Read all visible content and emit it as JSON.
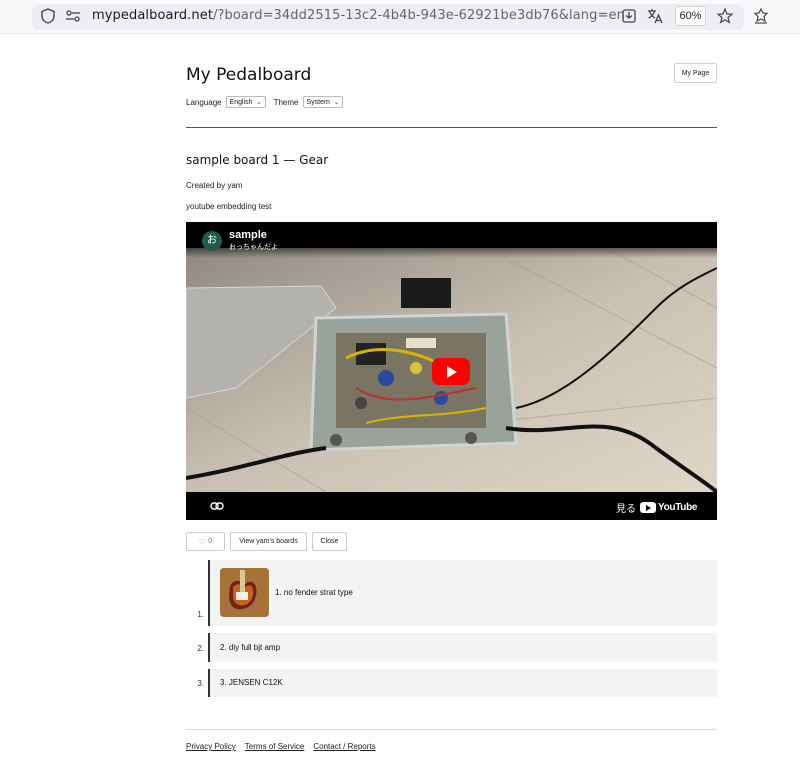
{
  "browser": {
    "url_host": "mypedalboard.net",
    "url_rest": "/?board=34dd2515-13c2-4b4b-943e-62921be3db76&lang=en",
    "zoom": "60%"
  },
  "header": {
    "site_title": "My Pedalboard",
    "my_page_label": "My Page",
    "language_label": "Language",
    "language_value": "English",
    "theme_label": "Theme",
    "theme_value": "System"
  },
  "board": {
    "title": "sample board 1 — Gear",
    "created_by": "Created by yam",
    "description": "youtube embedding test"
  },
  "video": {
    "channel_initial": "お",
    "title": "sample",
    "channel_name": "おっちゃんだよ",
    "watch_on": "見る",
    "youtube_word": "YouTube"
  },
  "actions": {
    "like_count": "0",
    "view_boards_label": "View yam's boards",
    "close_label": "Close"
  },
  "gear": [
    {
      "num": "1.",
      "label": "1. no fender strat type"
    },
    {
      "num": "2.",
      "label": "2. diy full bjt amp"
    },
    {
      "num": "3.",
      "label": "3. JENSEN C12K"
    }
  ],
  "footer": {
    "privacy": "Privacy Policy",
    "terms": "Terms of Service",
    "contact": "Contact / Reports"
  },
  "colors": {
    "accent_like": "#d04b5a",
    "play_red": "#ff0000"
  }
}
